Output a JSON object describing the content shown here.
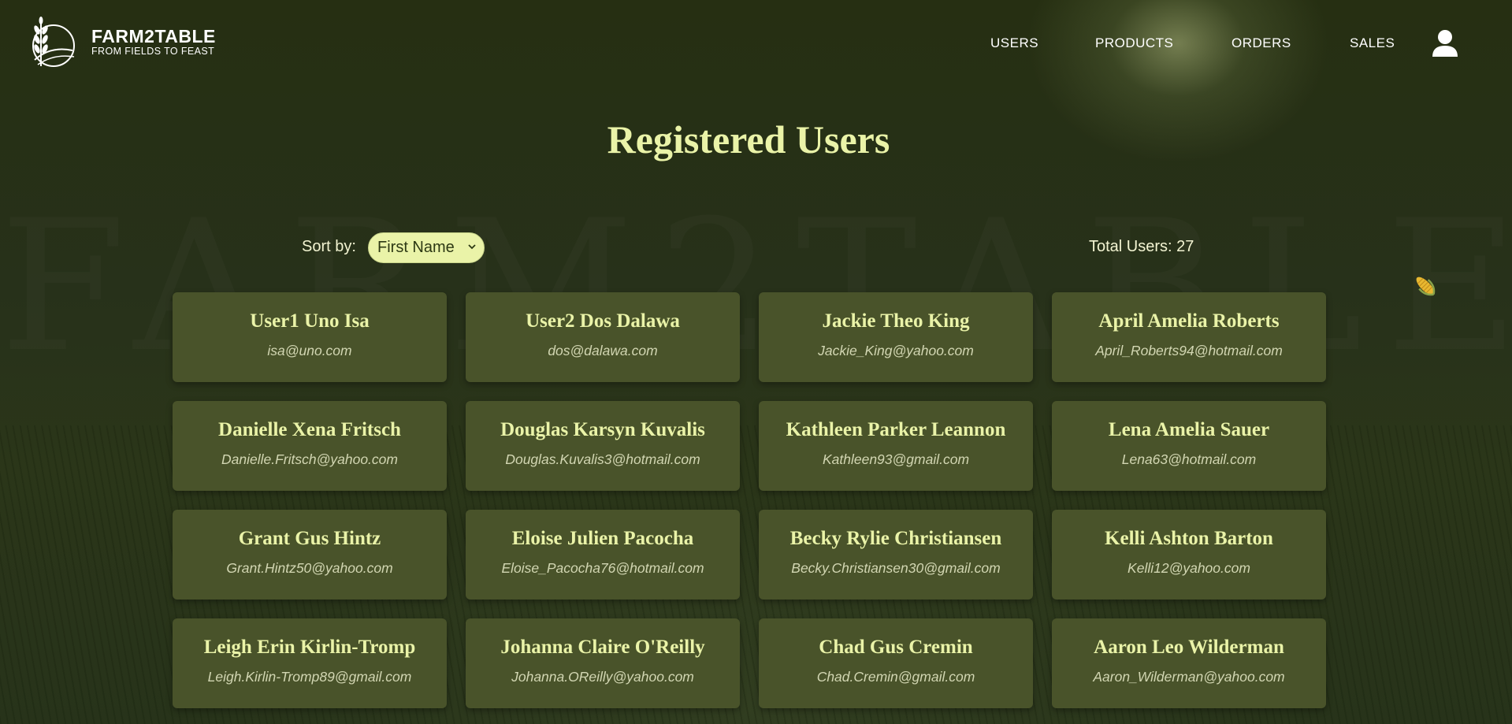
{
  "brand": {
    "title": "FARM2TABLE",
    "tagline": "FROM FIELDS TO FEAST",
    "watermark": "FARM2TABLE"
  },
  "nav": {
    "items": [
      "USERS",
      "PRODUCTS",
      "ORDERS",
      "SALES"
    ],
    "avatar_icon": "user-avatar-icon"
  },
  "page": {
    "title": "Registered Users"
  },
  "controls": {
    "sort_label": "Sort by:",
    "sort_selected": "First Name",
    "total_users_label": "Total Users: 27"
  },
  "users": [
    {
      "name": "User1 Uno Isa",
      "email": "isa@uno.com"
    },
    {
      "name": "User2 Dos Dalawa",
      "email": "dos@dalawa.com"
    },
    {
      "name": "Jackie Theo King",
      "email": "Jackie_King@yahoo.com"
    },
    {
      "name": "April Amelia Roberts",
      "email": "April_Roberts94@hotmail.com"
    },
    {
      "name": "Danielle Xena Fritsch",
      "email": "Danielle.Fritsch@yahoo.com"
    },
    {
      "name": "Douglas Karsyn Kuvalis",
      "email": "Douglas.Kuvalis3@hotmail.com"
    },
    {
      "name": "Kathleen Parker Leannon",
      "email": "Kathleen93@gmail.com"
    },
    {
      "name": "Lena Amelia Sauer",
      "email": "Lena63@hotmail.com"
    },
    {
      "name": "Grant Gus Hintz",
      "email": "Grant.Hintz50@yahoo.com"
    },
    {
      "name": "Eloise Julien Pacocha",
      "email": "Eloise_Pacocha76@hotmail.com"
    },
    {
      "name": "Becky Rylie Christiansen",
      "email": "Becky.Christiansen30@gmail.com"
    },
    {
      "name": "Kelli Ashton Barton",
      "email": "Kelli12@yahoo.com"
    },
    {
      "name": "Leigh Erin Kirlin-Tromp",
      "email": "Leigh.Kirlin-Tromp89@gmail.com"
    },
    {
      "name": "Johanna Claire O'Reilly",
      "email": "Johanna.OReilly@yahoo.com"
    },
    {
      "name": "Chad Gus Cremin",
      "email": "Chad.Cremin@gmail.com"
    },
    {
      "name": "Aaron Leo Wilderman",
      "email": "Aaron_Wilderman@yahoo.com"
    }
  ],
  "colors": {
    "background": "#252f13",
    "card": "#49532a",
    "accent": "#eaf3a8",
    "text_light": "#d2d6b2"
  }
}
